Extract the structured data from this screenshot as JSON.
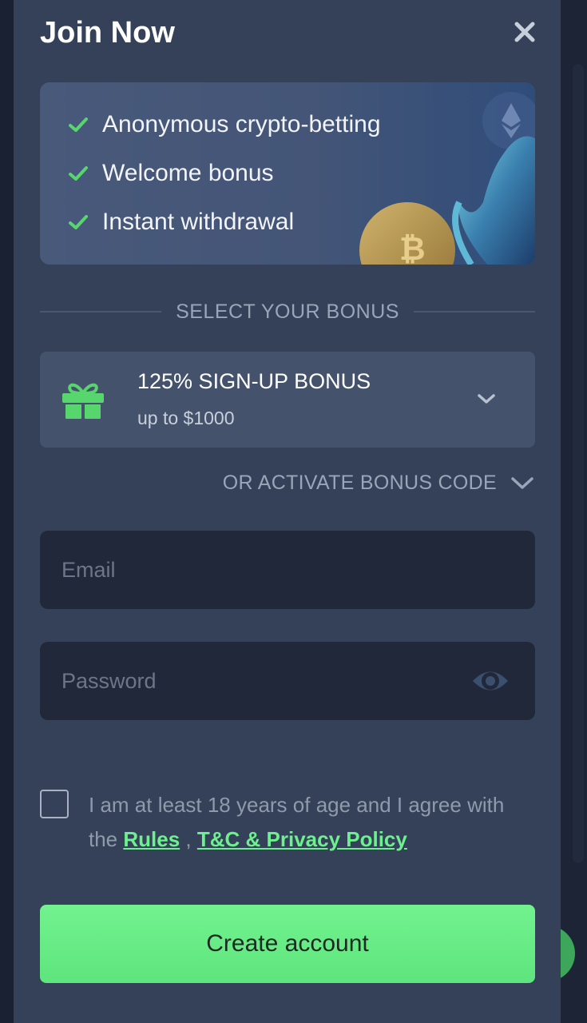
{
  "modal": {
    "title": "Join Now"
  },
  "promo": {
    "items": [
      {
        "label": "Anonymous crypto-betting"
      },
      {
        "label": "Welcome bonus"
      },
      {
        "label": "Instant withdrawal"
      }
    ]
  },
  "bonus_section": {
    "heading": "SELECT YOUR BONUS",
    "selected": {
      "title": "125% SIGN-UP BONUS",
      "subtitle": "up to $1000"
    },
    "code_toggle": "OR ACTIVATE BONUS CODE"
  },
  "form": {
    "email": {
      "placeholder": "Email",
      "value": ""
    },
    "password": {
      "placeholder": "Password",
      "value": ""
    }
  },
  "terms": {
    "text_before": "I am at least 18 years of age and I agree with the ",
    "rules_link": "Rules",
    "separator": " , ",
    "policy_link": "T&C & Privacy Policy"
  },
  "submit": {
    "label": "Create account"
  },
  "colors": {
    "accent_green": "#6df08e",
    "modal_bg": "#344158",
    "input_bg": "#212839"
  }
}
